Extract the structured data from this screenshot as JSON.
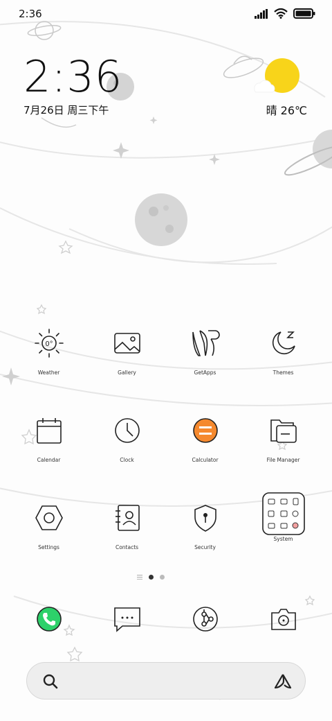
{
  "status_bar": {
    "time": "2:36",
    "icons": [
      "signal-icon",
      "wifi-icon",
      "battery-icon"
    ]
  },
  "clock_widget": {
    "time": "2:36",
    "date": "7月26日 周三下午"
  },
  "weather_widget": {
    "condition_temp": "晴 26℃",
    "icon": "sunny-cloud-icon",
    "sun_color": "#F8D41A"
  },
  "apps": [
    {
      "label": "Weather",
      "icon": "weather-icon"
    },
    {
      "label": "Gallery",
      "icon": "gallery-icon"
    },
    {
      "label": "GetApps",
      "icon": "getapps-icon"
    },
    {
      "label": "Themes",
      "icon": "themes-icon"
    },
    {
      "label": "Calendar",
      "icon": "calendar-icon"
    },
    {
      "label": "Clock",
      "icon": "clock-icon"
    },
    {
      "label": "Calculator",
      "icon": "calculator-icon"
    },
    {
      "label": "File Manager",
      "icon": "file-manager-icon"
    },
    {
      "label": "Settings",
      "icon": "settings-icon"
    },
    {
      "label": "Contacts",
      "icon": "contacts-icon"
    },
    {
      "label": "Security",
      "icon": "security-icon"
    },
    {
      "label": "System",
      "icon": "system-folder-icon"
    }
  ],
  "page_indicator": {
    "pages": 2,
    "current": 1
  },
  "dock": [
    {
      "name": "phone",
      "icon": "phone-icon",
      "color": "#2DD16A"
    },
    {
      "name": "messages",
      "icon": "messages-icon"
    },
    {
      "name": "browser",
      "icon": "browser-icon"
    },
    {
      "name": "camera",
      "icon": "camera-icon"
    }
  ],
  "search_bar": {
    "left_icon": "search-icon",
    "right_icon": "assistant-icon"
  },
  "colors": {
    "calculator_accent": "#F5892E",
    "phone_green": "#2DD16A",
    "weather_sun": "#F8D41A"
  }
}
